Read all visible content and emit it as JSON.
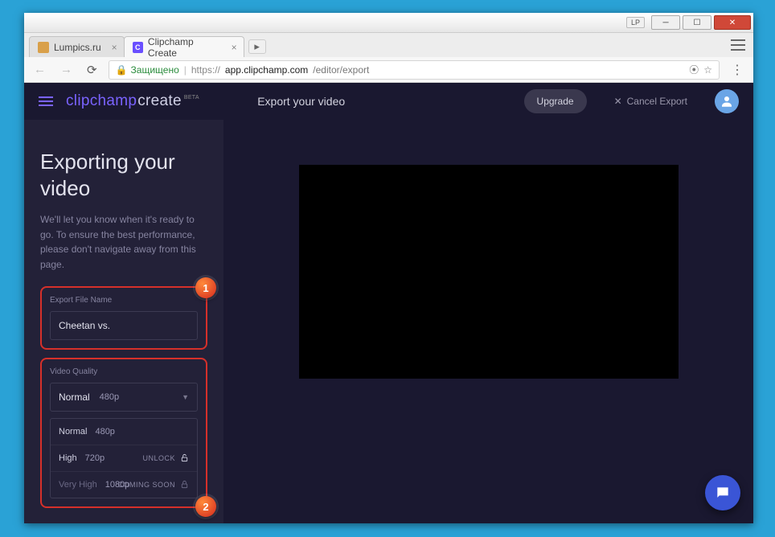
{
  "titlebar": {
    "lp": "LP"
  },
  "tabs": [
    {
      "label": "Lumpics.ru",
      "favicon_bg": "#d94",
      "favicon_text": ""
    },
    {
      "label": "Clipchamp Create",
      "favicon_bg": "#6a4fff",
      "favicon_text": "C"
    }
  ],
  "addr": {
    "secure": "Защищено",
    "proto": "https://",
    "host": "app.clipchamp.com",
    "path": "/editor/export"
  },
  "header": {
    "brand_a": "clipchamp",
    "brand_b": "create",
    "beta": "BETA",
    "title": "Export your video",
    "upgrade": "Upgrade",
    "cancel": "Cancel Export"
  },
  "sidebar": {
    "heading": "Exporting your video",
    "desc": "We'll let you know when it's ready to go. To ensure the best performance, please don't navigate away from this page.",
    "filename_label": "Export File Name",
    "filename_value": "Cheetan vs.",
    "quality_label": "Video Quality",
    "selected_quality": "Normal",
    "selected_res": "480p",
    "options": [
      {
        "name": "Normal",
        "res": "480p",
        "tag": ""
      },
      {
        "name": "High",
        "res": "720p",
        "tag": "UNLOCK"
      },
      {
        "name": "Very High",
        "res": "1080p",
        "tag": "COMING SOON"
      }
    ],
    "badge1": "1",
    "badge2": "2"
  }
}
